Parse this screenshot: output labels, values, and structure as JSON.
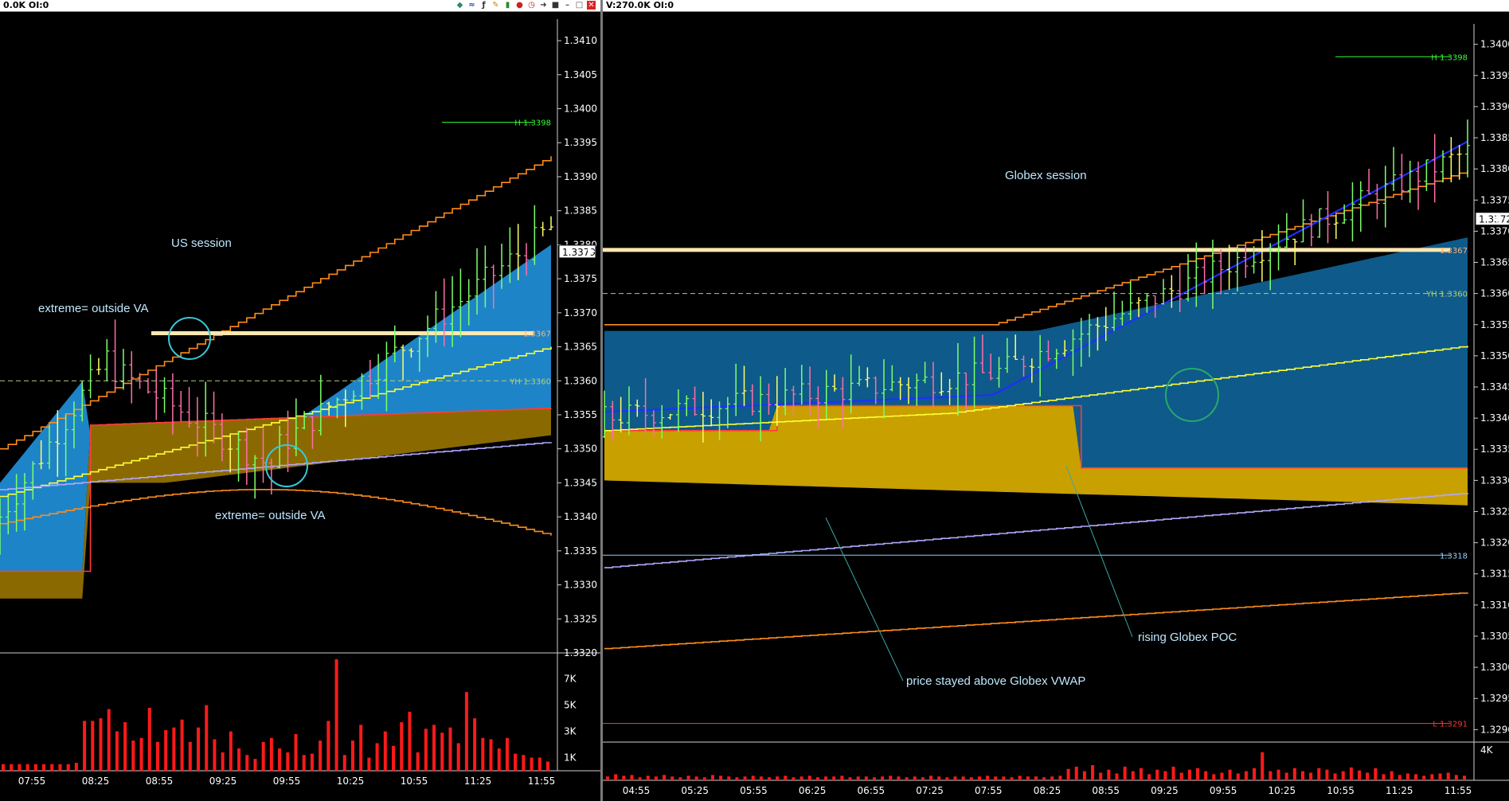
{
  "windows": {
    "left_title": "0.0K OI:0",
    "right_title": "V:270.0K OI:0"
  },
  "colors": {
    "up_bar": "#7dff6a",
    "down_bar": "#ff6fa8",
    "neutral_bar": "#ffff66",
    "value_area_upper": "#1e84c8",
    "value_area_upper_dark": "#0e5a8a",
    "value_area_lower": "#c8a000",
    "value_area_lower_dark": "#8a6a00",
    "vwap": "#ffff33",
    "poc": "#b0a8ff",
    "bands": "#ff8c1a",
    "volume": "#ff1a1a",
    "blue_ma": "#1e2fff"
  },
  "chart_data": [
    {
      "type": "candlestick",
      "name": "left",
      "title": "",
      "y_ticks": [
        "1.3410",
        "1.3405",
        "1.3400",
        "1.3395",
        "1.3390",
        "1.3385",
        "1.3380",
        "1.3375",
        "1.3370",
        "1.3365",
        "1.3360",
        "1.3355",
        "1.3350",
        "1.3345",
        "1.3340",
        "1.3335",
        "1.3330",
        "1.3325",
        "1.3320"
      ],
      "x_ticks": [
        "07:55",
        "08:25",
        "08:55",
        "09:25",
        "09:55",
        "10:25",
        "10:55",
        "11:25",
        "11:55"
      ],
      "ylim": [
        1.332,
        1.3412
      ],
      "current_price_label": "1.3379",
      "levels": [
        {
          "label": "H 1.3398",
          "value": 1.3398,
          "color": "#33ff33"
        },
        {
          "label": "1.3367",
          "value": 1.3367,
          "color": "#ffb070"
        },
        {
          "label": "YH 1.3360",
          "value": 1.336,
          "color": "#b8d070"
        }
      ],
      "annotations": [
        "US session",
        "extreme= outside VA",
        "extreme= outside VA"
      ],
      "volume_ticks": [
        "7K",
        "5K",
        "3K",
        "1K"
      ],
      "volume": [
        0.5,
        0.5,
        0.5,
        0.5,
        0.5,
        0.5,
        0.5,
        0.5,
        0.5,
        0.6,
        3.8,
        3.8,
        4.0,
        4.7,
        3.0,
        3.7,
        2.3,
        2.5,
        4.8,
        2.2,
        3.1,
        3.3,
        3.9,
        2.2,
        3.3,
        5.0,
        2.4,
        1.4,
        3.0,
        1.7,
        1.2,
        0.9,
        2.2,
        2.5,
        1.7,
        1.4,
        2.8,
        1.2,
        1.3,
        2.3,
        3.8,
        8.5,
        1.2,
        2.3,
        3.5,
        1.0,
        2.1,
        3.0,
        1.9,
        3.7,
        4.5,
        1.4,
        3.2,
        3.5,
        2.9,
        3.3,
        2.1,
        6.0,
        4.0,
        2.5,
        2.4,
        1.7,
        2.5,
        1.3,
        1.2,
        1.0,
        1.0,
        0.7
      ]
    },
    {
      "type": "candlestick",
      "name": "right",
      "title": "",
      "y_ticks": [
        "1.3400",
        "1.3395",
        "1.3390",
        "1.3385",
        "1.3380",
        "1.3375",
        "1.3370",
        "1.3365",
        "1.3360",
        "1.3355",
        "1.3350",
        "1.3345",
        "1.3340",
        "1.3335",
        "1.3330",
        "1.3325",
        "1.3320",
        "1.3315",
        "1.3310",
        "1.3305",
        "1.3300",
        "1.3295",
        "1.3290"
      ],
      "x_ticks": [
        "04:55",
        "05:25",
        "05:55",
        "06:25",
        "06:55",
        "07:25",
        "07:55",
        "08:25",
        "08:55",
        "09:25",
        "09:55",
        "10:25",
        "10:55",
        "11:25",
        "11:55"
      ],
      "ylim": [
        1.3288,
        1.3402
      ],
      "current_price_label": "1.3372",
      "levels": [
        {
          "label": "H 1.3398",
          "value": 1.3398,
          "color": "#33ff33"
        },
        {
          "label": "1.3367",
          "value": 1.3367,
          "color": "#ffb070"
        },
        {
          "label": "YH 1.3360",
          "value": 1.336,
          "color": "#b8d070"
        },
        {
          "label": "1.3318",
          "value": 1.3318,
          "color": "#8fd0ff"
        },
        {
          "label": "L 1.3291",
          "value": 1.3291,
          "color": "#ff3333"
        }
      ],
      "annotations": [
        "Globex session",
        "rising Globex POC",
        "price stayed above Globex VWAP"
      ],
      "volume_ticks": [
        "4K"
      ],
      "volume": [
        0.5,
        0.8,
        0.6,
        0.7,
        0.4,
        0.6,
        0.5,
        0.7,
        0.5,
        0.4,
        0.6,
        0.5,
        0.4,
        0.7,
        0.6,
        0.5,
        0.4,
        0.5,
        0.6,
        0.5,
        0.4,
        0.5,
        0.6,
        0.4,
        0.5,
        0.6,
        0.4,
        0.5,
        0.5,
        0.6,
        0.4,
        0.5,
        0.5,
        0.4,
        0.5,
        0.6,
        0.5,
        0.4,
        0.5,
        0.4,
        0.6,
        0.5,
        0.4,
        0.5,
        0.5,
        0.4,
        0.5,
        0.6,
        0.5,
        0.5,
        0.4,
        0.6,
        0.5,
        0.5,
        0.4,
        0.5,
        0.6,
        1.5,
        1.8,
        1.2,
        2.0,
        1.0,
        1.4,
        0.9,
        1.8,
        1.2,
        1.6,
        0.8,
        1.4,
        1.2,
        1.8,
        1.0,
        1.4,
        1.6,
        1.2,
        0.8,
        1.0,
        1.4,
        0.9,
        1.2,
        1.6,
        3.7,
        1.2,
        1.4,
        1.0,
        1.6,
        1.2,
        1.0,
        1.6,
        1.4,
        0.9,
        1.2,
        1.7,
        1.3,
        1.0,
        1.6,
        0.8,
        1.2,
        0.7,
        0.9,
        0.8,
        0.6,
        0.8,
        0.9,
        1.0,
        0.7,
        0.6
      ]
    }
  ]
}
